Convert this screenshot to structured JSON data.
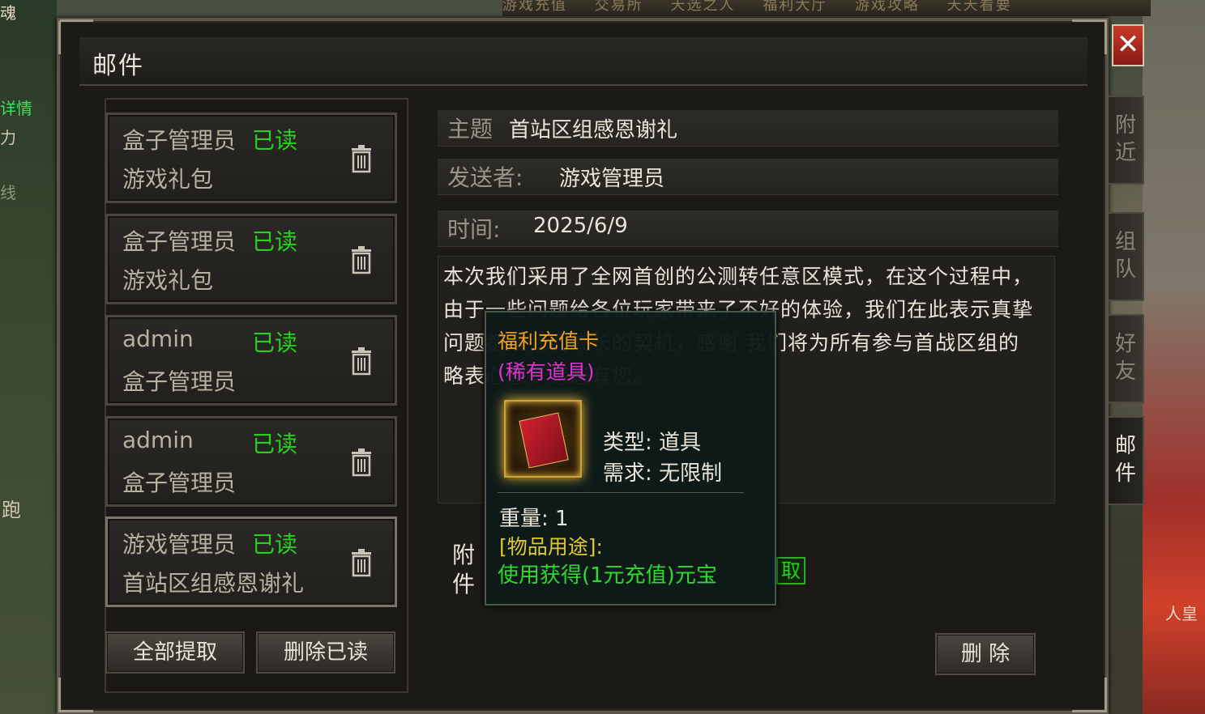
{
  "window": {
    "title": "邮件",
    "close_icon": "✕"
  },
  "topbar": [
    "游戏充值",
    "交易所",
    "天选之人",
    "福利大厅",
    "游戏攻略",
    "天天看要"
  ],
  "left_edge": [
    "魂",
    "详情",
    "力",
    "线",
    "跑"
  ],
  "mail_list": [
    {
      "sender": "盒子管理员",
      "status": "已读",
      "subject": "游戏礼包"
    },
    {
      "sender": "盒子管理员",
      "status": "已读",
      "subject": "游戏礼包"
    },
    {
      "sender": "admin",
      "status": "已读",
      "subject": "盒子管理员"
    },
    {
      "sender": "admin",
      "status": "已读",
      "subject": "盒子管理员"
    },
    {
      "sender": "游戏管理员",
      "status": "已读",
      "subject": "首站区组感恩谢礼"
    }
  ],
  "buttons": {
    "take_all": "全部提取",
    "delete_read": "删除已读",
    "delete": "删 除",
    "claim": "取"
  },
  "detail": {
    "subject_label": "主题",
    "subject": "首站区组感恩谢礼",
    "sender_label": "发送者:",
    "sender": "游戏管理员",
    "time_label": "时间:",
    "time": "2025/6/9",
    "body": "本次我们采用了全网首创的公测转任意区模式，在这个过程中，由于一些问题给各位玩家带来了不好的体验，我们在此表示真挚 问题都是我们成长的契机，感谢 我们将为所有参与首战区组的 略表心意，感恩有您。",
    "attachment_label": "附件"
  },
  "side_tabs": [
    "附近",
    "组队",
    "好友",
    "邮件"
  ],
  "right_edge": "人皇",
  "tooltip": {
    "name": "福利充值卡",
    "rarity": "(稀有道具)",
    "type": "类型: 道具",
    "requirement": "需求: 无限制",
    "weight": "重量: 1",
    "use_heading": "[物品用途]:",
    "use": "使用获得(1元充值)元宝",
    "icon": "red-card-book-icon"
  },
  "colors": {
    "read_status": "#28d020",
    "item_name": "#f0a020",
    "rarity": "#e030d0",
    "use_text": "#30d830",
    "close": "#c83a2a"
  }
}
